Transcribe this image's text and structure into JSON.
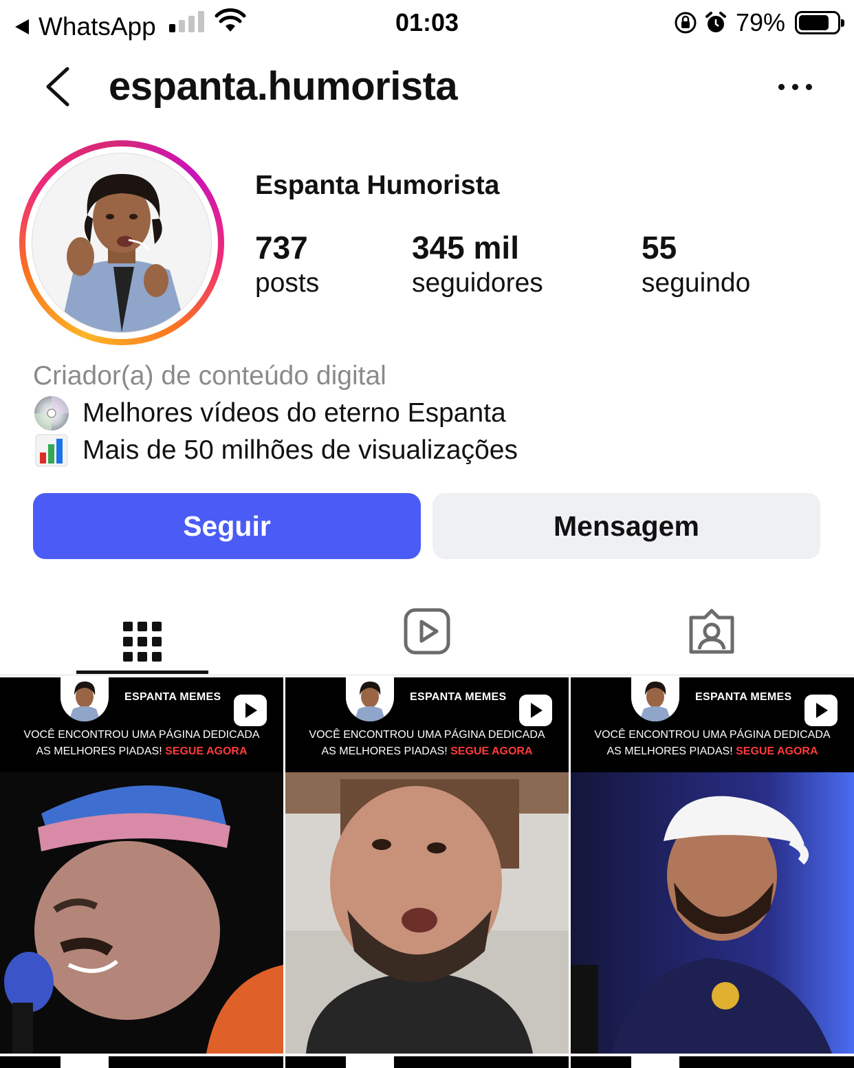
{
  "status_bar": {
    "back_app": "WhatsApp",
    "time": "01:03",
    "battery_percent": "79%",
    "signal_bars_active": 1,
    "signal_bars_total": 4,
    "battery_level": 0.79
  },
  "header": {
    "username": "espanta.humorista"
  },
  "profile": {
    "display_name": "Espanta Humorista",
    "stats": [
      {
        "value": "737",
        "label": "posts"
      },
      {
        "value": "345 mil",
        "label": "seguidores"
      },
      {
        "value": "55",
        "label": "seguindo"
      }
    ],
    "bio": {
      "category": "Criador(a) de conteúdo digital",
      "lines": [
        {
          "icon": "dvd-disc-icon",
          "text": "Melhores vídeos do eterno Espanta"
        },
        {
          "icon": "bar-chart-icon",
          "text": "Mais de 50 milhões de visualizações"
        }
      ]
    }
  },
  "actions": {
    "follow_label": "Seguir",
    "message_label": "Mensagem"
  },
  "tabs": [
    {
      "icon": "grid-icon",
      "active": true
    },
    {
      "icon": "reels-icon",
      "active": false
    },
    {
      "icon": "tagged-icon",
      "active": false
    }
  ],
  "posts": [
    {
      "title": "ESPANTA MEMES",
      "caption_line1": "VOCÊ ENCONTROU UMA PÁGINA DEDICADA",
      "caption_line2_prefix": "AS MELHORES PIADAS! ",
      "caption_highlight": "SEGUE AGORA",
      "type": "reel"
    },
    {
      "title": "ESPANTA MEMES",
      "caption_line1": "VOCÊ ENCONTROU UMA PÁGINA DEDICADA",
      "caption_line2_prefix": "AS MELHORES PIADAS! ",
      "caption_highlight": "SEGUE AGORA",
      "type": "reel"
    },
    {
      "title": "ESPANTA MEMES",
      "caption_line1": "VOCÊ ENCONTROU UMA PÁGINA DEDICADA",
      "caption_line2_prefix": "AS MELHORES PIADAS! ",
      "caption_highlight": "SEGUE AGORA",
      "type": "reel"
    }
  ],
  "colors": {
    "follow_button": "#4a5cf5",
    "message_button": "#eff0f3",
    "caption_highlight": "#ff3b3b"
  }
}
